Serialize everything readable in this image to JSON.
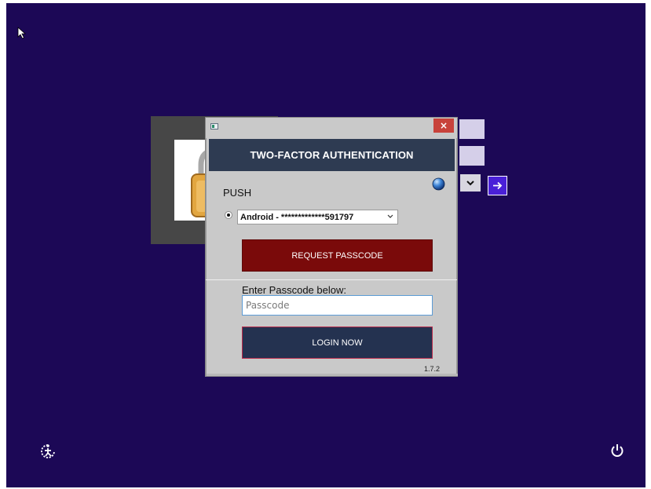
{
  "dialog": {
    "header_title": "TWO-FACTOR AUTHENTICATION",
    "close_glyph": "×",
    "method_label": "PUSH",
    "device_selected": "Android - *************591797",
    "request_button_label": "REQUEST PASSCODE",
    "passcode_prompt": "Enter Passcode below:",
    "passcode_value": "",
    "passcode_placeholder": "Passcode",
    "login_button_label": "LOGIN NOW",
    "version": "1.7.2"
  },
  "icons": {
    "app": "app-icon",
    "close": "close-icon",
    "globe": "globe-icon",
    "lock": "lock-icon",
    "chevron": "chevron-down-icon",
    "submit": "arrow-right-icon",
    "ease_of_access": "ease-of-access-icon",
    "power": "power-icon"
  },
  "colors": {
    "desktop_background": "#1c0856",
    "header_band": "#2e3b52",
    "request_button": "#7a0a0a",
    "login_button": "#243250",
    "close_button": "#c8423a",
    "submit_arrow": "#4a20d8"
  }
}
